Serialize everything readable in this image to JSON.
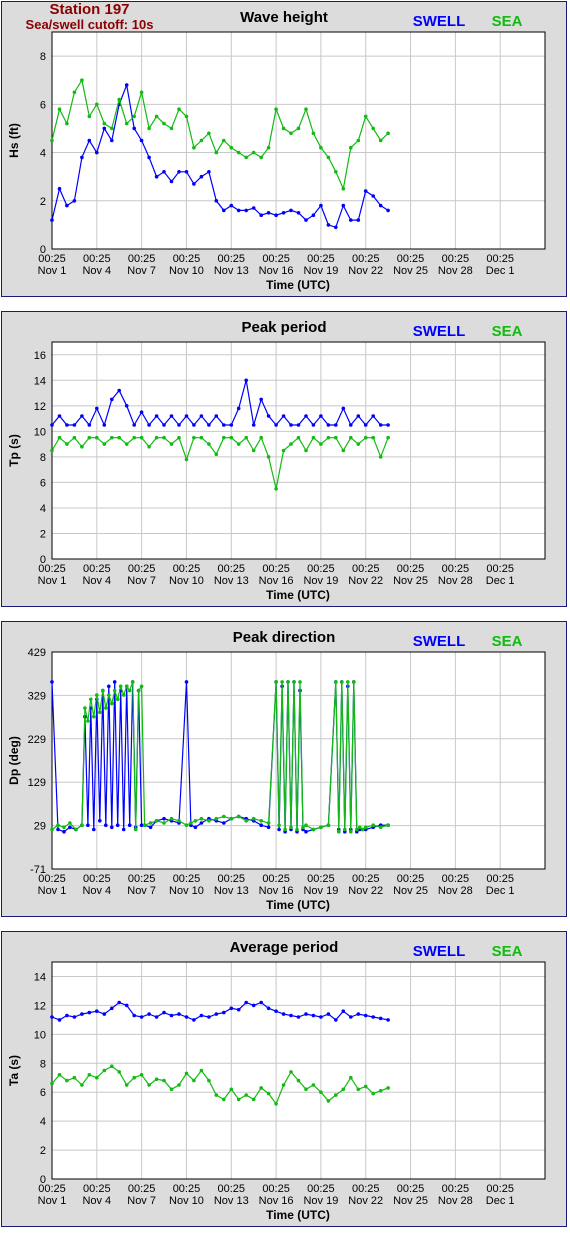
{
  "station": {
    "name": "Station 197",
    "cutoff": "Sea/swell cutoff: 10s"
  },
  "colors": {
    "swell": "#0000ff",
    "sea": "#11bb11",
    "grid": "#c8c8c8",
    "background": "#dcdcdc"
  },
  "legend": {
    "swell": "SWELL",
    "sea": "SEA"
  },
  "x_axis": {
    "label": "Time (UTC)",
    "days": [
      1,
      34
    ],
    "tick_days": [
      1,
      4,
      7,
      10,
      13,
      16,
      19,
      22,
      25,
      28,
      31
    ],
    "tick_labels": [
      [
        "00:25",
        "Nov 1"
      ],
      [
        "00:25",
        "Nov 4"
      ],
      [
        "00:25",
        "Nov 7"
      ],
      [
        "00:25",
        "Nov 10"
      ],
      [
        "00:25",
        "Nov 13"
      ],
      [
        "00:25",
        "Nov 16"
      ],
      [
        "00:25",
        "Nov 19"
      ],
      [
        "00:25",
        "Nov 22"
      ],
      [
        "00:25",
        "Nov 25"
      ],
      [
        "00:25",
        "Nov 28"
      ],
      [
        "00:25",
        "Dec 1"
      ]
    ]
  },
  "chart_data": [
    {
      "type": "line",
      "title": "Wave height",
      "xlabel": "Time (UTC)",
      "ylabel": "Hs (ft)",
      "ylim": [
        0,
        9
      ],
      "yticks": [
        0,
        2,
        4,
        6,
        8
      ],
      "grid": true,
      "legend_position": "top-right",
      "series": [
        {
          "name": "SWELL",
          "color": "#0000ff",
          "x": [
            1,
            1.5,
            2,
            2.5,
            3,
            3.5,
            4,
            4.5,
            5,
            5.5,
            6,
            6.5,
            7,
            7.5,
            8,
            8.5,
            9,
            9.5,
            10,
            10.5,
            11,
            11.5,
            12,
            12.5,
            13,
            13.5,
            14,
            14.5,
            15,
            15.5,
            16,
            16.5,
            17,
            17.5,
            18,
            18.5,
            19,
            19.5,
            20,
            20.5,
            21,
            21.5,
            22,
            22.5,
            23,
            23.5
          ],
          "y": [
            1.2,
            2.5,
            1.8,
            2.0,
            3.8,
            4.5,
            4.0,
            5.0,
            4.5,
            6.0,
            6.8,
            5.0,
            4.5,
            3.8,
            3.0,
            3.2,
            2.8,
            3.2,
            3.2,
            2.7,
            3.0,
            3.2,
            2.0,
            1.6,
            1.8,
            1.6,
            1.6,
            1.7,
            1.4,
            1.5,
            1.4,
            1.5,
            1.6,
            1.5,
            1.2,
            1.4,
            1.8,
            1.0,
            0.9,
            1.8,
            1.2,
            1.2,
            2.4,
            2.2,
            1.8,
            1.6
          ]
        },
        {
          "name": "SEA",
          "color": "#11bb11",
          "x": [
            1,
            1.5,
            2,
            2.5,
            3,
            3.5,
            4,
            4.5,
            5,
            5.5,
            6,
            6.5,
            7,
            7.5,
            8,
            8.5,
            9,
            9.5,
            10,
            10.5,
            11,
            11.5,
            12,
            12.5,
            13,
            13.5,
            14,
            14.5,
            15,
            15.5,
            16,
            16.5,
            17,
            17.5,
            18,
            18.5,
            19,
            19.5,
            20,
            20.5,
            21,
            21.5,
            22,
            22.5,
            23,
            23.5
          ],
          "y": [
            4.5,
            5.8,
            5.2,
            6.5,
            7.0,
            5.5,
            6.0,
            5.2,
            5.0,
            6.2,
            5.2,
            5.5,
            6.5,
            5.0,
            5.5,
            5.2,
            5.0,
            5.8,
            5.5,
            4.2,
            4.5,
            4.8,
            4.0,
            4.5,
            4.2,
            4.0,
            3.8,
            4.0,
            3.8,
            4.2,
            5.8,
            5.0,
            4.8,
            5.0,
            5.8,
            4.8,
            4.2,
            3.8,
            3.2,
            2.5,
            4.2,
            4.5,
            5.5,
            5.0,
            4.5,
            4.8
          ]
        }
      ]
    },
    {
      "type": "line",
      "title": "Peak period",
      "xlabel": "Time (UTC)",
      "ylabel": "Tp (s)",
      "ylim": [
        0,
        17
      ],
      "yticks": [
        0,
        2,
        4,
        6,
        8,
        10,
        12,
        14,
        16
      ],
      "grid": true,
      "legend_position": "top-right",
      "series": [
        {
          "name": "SWELL",
          "color": "#0000ff",
          "x": [
            1,
            1.5,
            2,
            2.5,
            3,
            3.5,
            4,
            4.5,
            5,
            5.5,
            6,
            6.5,
            7,
            7.5,
            8,
            8.5,
            9,
            9.5,
            10,
            10.5,
            11,
            11.5,
            12,
            12.5,
            13,
            13.5,
            14,
            14.5,
            15,
            15.5,
            16,
            16.5,
            17,
            17.5,
            18,
            18.5,
            19,
            19.5,
            20,
            20.5,
            21,
            21.5,
            22,
            22.5,
            23,
            23.5
          ],
          "y": [
            10.5,
            11.2,
            10.5,
            10.5,
            11.2,
            10.5,
            11.8,
            10.5,
            12.5,
            13.2,
            12.0,
            10.5,
            11.5,
            10.5,
            11.2,
            10.5,
            11.2,
            10.5,
            11.2,
            10.5,
            11.2,
            10.5,
            11.2,
            10.5,
            10.5,
            11.8,
            14.0,
            10.5,
            12.5,
            11.2,
            10.5,
            11.2,
            10.5,
            10.5,
            11.2,
            10.5,
            11.2,
            10.5,
            10.5,
            11.8,
            10.5,
            11.2,
            10.5,
            11.2,
            10.5,
            10.5
          ]
        },
        {
          "name": "SEA",
          "color": "#11bb11",
          "x": [
            1,
            1.5,
            2,
            2.5,
            3,
            3.5,
            4,
            4.5,
            5,
            5.5,
            6,
            6.5,
            7,
            7.5,
            8,
            8.5,
            9,
            9.5,
            10,
            10.5,
            11,
            11.5,
            12,
            12.5,
            13,
            13.5,
            14,
            14.5,
            15,
            15.5,
            16,
            16.5,
            17,
            17.5,
            18,
            18.5,
            19,
            19.5,
            20,
            20.5,
            21,
            21.5,
            22,
            22.5,
            23,
            23.5
          ],
          "y": [
            8.5,
            9.5,
            9.0,
            9.5,
            8.8,
            9.5,
            9.5,
            9.0,
            9.5,
            9.5,
            9.0,
            9.5,
            9.5,
            8.8,
            9.5,
            9.5,
            9.0,
            9.5,
            7.8,
            9.5,
            9.5,
            9.0,
            8.2,
            9.5,
            9.5,
            9.0,
            9.5,
            8.5,
            9.5,
            8.0,
            5.5,
            8.5,
            9.0,
            9.5,
            8.5,
            9.5,
            9.0,
            9.5,
            9.5,
            8.5,
            9.5,
            9.0,
            9.5,
            9.5,
            8.0,
            9.5
          ]
        }
      ]
    },
    {
      "type": "line",
      "title": "Peak direction",
      "xlabel": "Time (UTC)",
      "ylabel": "Dp (deg)",
      "ylim": [
        -71,
        429
      ],
      "yticks": [
        -71,
        29,
        129,
        229,
        329,
        429
      ],
      "grid": true,
      "legend_position": "top-right",
      "series": [
        {
          "name": "SWELL",
          "color": "#0000ff",
          "x": [
            1,
            1.4,
            1.8,
            2.2,
            2.6,
            3.0,
            3.2,
            3.4,
            3.6,
            3.8,
            4.0,
            4.2,
            4.4,
            4.6,
            4.8,
            5.0,
            5.2,
            5.4,
            5.6,
            5.8,
            6.0,
            6.2,
            6.4,
            6.6,
            6.8,
            7.0,
            7.2,
            7.6,
            8.0,
            8.5,
            9.0,
            9.5,
            10.0,
            10.3,
            10.6,
            11.0,
            11.5,
            12.0,
            12.5,
            13.0,
            13.5,
            14.0,
            14.5,
            15.0,
            15.5,
            16.0,
            16.2,
            16.4,
            16.6,
            16.8,
            17.0,
            17.2,
            17.4,
            17.6,
            17.8,
            18.0,
            18.5,
            19.0,
            19.5,
            20.0,
            20.2,
            20.4,
            20.6,
            20.8,
            21.0,
            21.2,
            21.4,
            21.6,
            21.8,
            22.0,
            22.5,
            23.0,
            23.5
          ],
          "y": [
            360,
            20,
            15,
            25,
            20,
            30,
            280,
            30,
            300,
            20,
            320,
            40,
            340,
            30,
            350,
            25,
            360,
            30,
            340,
            20,
            350,
            30,
            360,
            25,
            340,
            30,
            30,
            25,
            40,
            45,
            40,
            35,
            360,
            30,
            25,
            35,
            45,
            40,
            35,
            45,
            50,
            45,
            40,
            30,
            25,
            360,
            20,
            350,
            15,
            360,
            20,
            360,
            15,
            340,
            20,
            15,
            20,
            25,
            30,
            360,
            20,
            360,
            15,
            350,
            20,
            360,
            15,
            20,
            20,
            20,
            25,
            30,
            30
          ]
        },
        {
          "name": "SEA",
          "color": "#11bb11",
          "x": [
            1,
            1.4,
            1.8,
            2.2,
            2.6,
            3.0,
            3.2,
            3.4,
            3.6,
            3.8,
            4.0,
            4.2,
            4.4,
            4.6,
            4.8,
            5.0,
            5.2,
            5.4,
            5.6,
            5.8,
            6.0,
            6.2,
            6.4,
            6.6,
            6.8,
            7.0,
            7.2,
            7.6,
            8.0,
            8.5,
            9.0,
            9.5,
            10.0,
            10.3,
            10.6,
            11.0,
            11.5,
            12.0,
            12.5,
            13.0,
            13.5,
            14.0,
            14.5,
            15.0,
            15.5,
            16.0,
            16.2,
            16.4,
            16.6,
            16.8,
            17.0,
            17.2,
            17.4,
            17.6,
            17.8,
            18.0,
            18.5,
            19.0,
            19.5,
            20.0,
            20.2,
            20.4,
            20.6,
            20.8,
            21.0,
            21.2,
            21.4,
            21.6,
            21.8,
            22.0,
            22.5,
            23.0,
            23.5
          ],
          "y": [
            20,
            30,
            25,
            35,
            20,
            30,
            300,
            270,
            320,
            280,
            330,
            290,
            340,
            300,
            330,
            310,
            340,
            320,
            350,
            330,
            350,
            340,
            360,
            20,
            340,
            350,
            30,
            35,
            40,
            35,
            45,
            40,
            30,
            35,
            40,
            45,
            40,
            45,
            50,
            45,
            50,
            40,
            45,
            40,
            35,
            360,
            30,
            360,
            20,
            360,
            25,
            360,
            20,
            360,
            25,
            30,
            20,
            25,
            30,
            360,
            15,
            360,
            20,
            360,
            15,
            360,
            20,
            25,
            20,
            25,
            30,
            25,
            30
          ]
        }
      ]
    },
    {
      "type": "line",
      "title": "Average period",
      "xlabel": "Time (UTC)",
      "ylabel": "Ta (s)",
      "ylim": [
        0,
        15
      ],
      "yticks": [
        0,
        2,
        4,
        6,
        8,
        10,
        12,
        14
      ],
      "grid": true,
      "legend_position": "top-right",
      "series": [
        {
          "name": "SWELL",
          "color": "#0000ff",
          "x": [
            1,
            1.5,
            2,
            2.5,
            3,
            3.5,
            4,
            4.5,
            5,
            5.5,
            6,
            6.5,
            7,
            7.5,
            8,
            8.5,
            9,
            9.5,
            10,
            10.5,
            11,
            11.5,
            12,
            12.5,
            13,
            13.5,
            14,
            14.5,
            15,
            15.5,
            16,
            16.5,
            17,
            17.5,
            18,
            18.5,
            19,
            19.5,
            20,
            20.5,
            21,
            21.5,
            22,
            22.5,
            23,
            23.5
          ],
          "y": [
            11.2,
            11.0,
            11.3,
            11.2,
            11.4,
            11.5,
            11.6,
            11.4,
            11.8,
            12.2,
            12.0,
            11.3,
            11.2,
            11.4,
            11.2,
            11.5,
            11.3,
            11.4,
            11.2,
            11.0,
            11.3,
            11.2,
            11.4,
            11.5,
            11.8,
            11.7,
            12.2,
            12.0,
            12.2,
            11.8,
            11.6,
            11.4,
            11.3,
            11.2,
            11.4,
            11.3,
            11.2,
            11.4,
            11.0,
            11.6,
            11.2,
            11.4,
            11.3,
            11.2,
            11.1,
            11.0
          ]
        },
        {
          "name": "SEA",
          "color": "#11bb11",
          "x": [
            1,
            1.5,
            2,
            2.5,
            3,
            3.5,
            4,
            4.5,
            5,
            5.5,
            6,
            6.5,
            7,
            7.5,
            8,
            8.5,
            9,
            9.5,
            10,
            10.5,
            11,
            11.5,
            12,
            12.5,
            13,
            13.5,
            14,
            14.5,
            15,
            15.5,
            16,
            16.5,
            17,
            17.5,
            18,
            18.5,
            19,
            19.5,
            20,
            20.5,
            21,
            21.5,
            22,
            22.5,
            23,
            23.5
          ],
          "y": [
            6.6,
            7.2,
            6.8,
            7.0,
            6.5,
            7.2,
            7.0,
            7.5,
            7.8,
            7.4,
            6.5,
            7.0,
            7.2,
            6.5,
            6.9,
            6.8,
            6.2,
            6.5,
            7.3,
            6.8,
            7.5,
            6.8,
            5.8,
            5.5,
            6.2,
            5.5,
            5.8,
            5.5,
            6.3,
            5.9,
            5.2,
            6.5,
            7.4,
            6.8,
            6.2,
            6.5,
            6.0,
            5.4,
            5.8,
            6.2,
            7.0,
            6.2,
            6.4,
            5.9,
            6.1,
            6.3
          ]
        }
      ]
    }
  ]
}
